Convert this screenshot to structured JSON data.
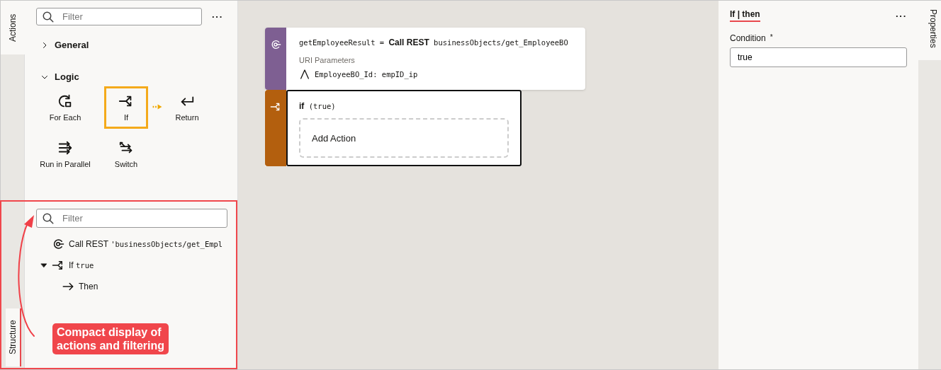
{
  "side_tabs": {
    "top": "Actions",
    "bottom": "Structure"
  },
  "actions_panel": {
    "filter": {
      "placeholder": "Filter"
    },
    "more": "···",
    "groups": [
      {
        "title": "General",
        "expanded": false
      },
      {
        "title": "Logic",
        "expanded": true,
        "items": [
          {
            "label": "For Each",
            "kind": "foreach",
            "highlighted": false
          },
          {
            "label": "If",
            "kind": "if",
            "highlighted": true
          },
          {
            "label": "Return",
            "kind": "return",
            "highlighted": false
          },
          {
            "label": "Run in Parallel",
            "kind": "parallel",
            "highlighted": false
          },
          {
            "label": "Switch",
            "kind": "switch",
            "highlighted": false
          }
        ]
      }
    ]
  },
  "structure_panel": {
    "filter": {
      "placeholder": "Filter"
    },
    "tree": [
      {
        "kind": "rest",
        "label": "Call REST",
        "code": "'businessObjects/get_Empl"
      },
      {
        "kind": "if",
        "label": "If",
        "code": "true",
        "expanded": true,
        "children": [
          {
            "kind": "then",
            "label": "Then"
          }
        ]
      }
    ]
  },
  "callout": "Compact display of actions and filtering",
  "canvas": {
    "nodes": [
      {
        "kind": "rest",
        "color": "#7e5f92",
        "head": [
          "getEmployeeResult = ",
          "Call REST",
          " businessObjects/get_EmployeeBO"
        ],
        "section": "URI Parameters",
        "param": "EmployeeBO_Id: empID_ip"
      },
      {
        "kind": "if",
        "color": "#b35f0e",
        "head": [
          "if",
          " (true)"
        ],
        "selected": true,
        "slot": "Add Action"
      }
    ]
  },
  "properties_panel": {
    "title": "If | then",
    "more": "···",
    "field_label": "Condition",
    "required": "*",
    "value": "true",
    "tab": "Properties"
  }
}
